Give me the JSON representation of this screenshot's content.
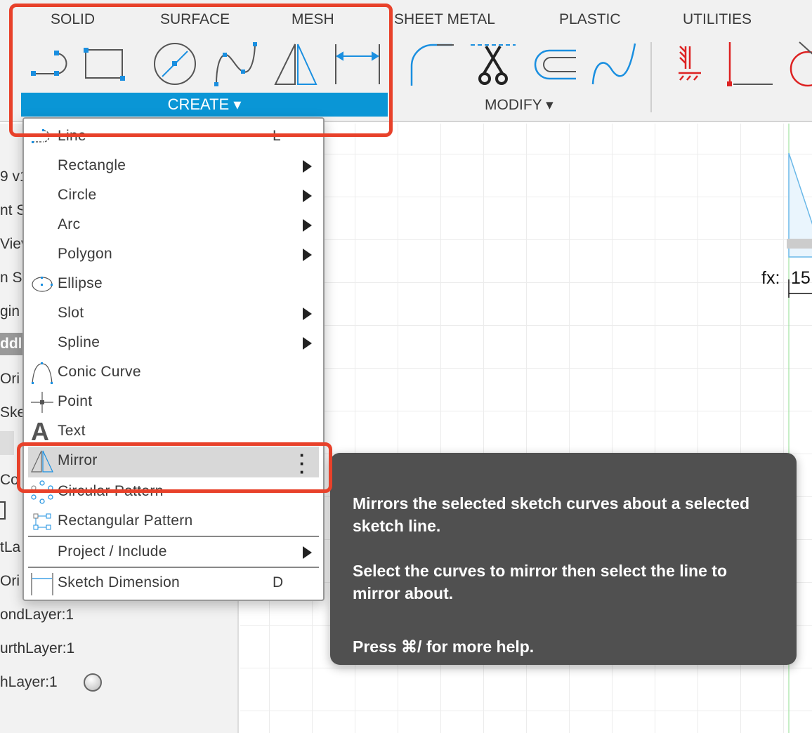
{
  "toolbar": {
    "tabs": [
      "SOLID",
      "SURFACE",
      "MESH",
      "SHEET METAL",
      "PLASTIC",
      "UTILITIES"
    ],
    "create_label": "CREATE",
    "modify_label": "MODIFY",
    "create_tools": [
      "line-icon",
      "rectangle-icon",
      "circle-icon",
      "spline-icon",
      "mirror-icon",
      "dimension-icon"
    ],
    "modify_tools": [
      "fillet-icon",
      "trim-icon",
      "offset-icon",
      "spline-icon"
    ],
    "constraint_tools": [
      "fix-constraint-icon",
      "coincident-icon",
      "tangent-icon"
    ],
    "accent": "#0a96d6"
  },
  "browser": {
    "partial_items": [
      "9 v1",
      "nt S",
      "Viev",
      "n Sc",
      "gin",
      "ddl",
      "Ori",
      "Ske",
      "Co",
      "tLa",
      "Ori",
      "ondLayer:1",
      "urthLayer:1",
      "hLayer:1"
    ]
  },
  "menu": {
    "items": [
      {
        "label": "Line",
        "shortcut": "L"
      },
      {
        "label": "Rectangle",
        "submenu": true
      },
      {
        "label": "Circle",
        "submenu": true
      },
      {
        "label": "Arc",
        "submenu": true
      },
      {
        "label": "Polygon",
        "submenu": true
      },
      {
        "label": "Ellipse"
      },
      {
        "label": "Slot",
        "submenu": true
      },
      {
        "label": "Spline",
        "submenu": true
      },
      {
        "label": "Conic Curve"
      },
      {
        "label": "Point"
      },
      {
        "label": "Text"
      },
      {
        "label": "Mirror",
        "highlighted": true
      },
      {
        "label": "Circular Pattern"
      },
      {
        "label": "Rectangular Pattern"
      },
      {
        "label": "Project / Include",
        "submenu": true
      },
      {
        "label": "Sketch Dimension",
        "shortcut": "D"
      }
    ]
  },
  "tooltip": {
    "line1": "Mirrors the selected sketch curves about a selected sketch line.",
    "line2": "Select the curves to mirror then select the line to mirror about.",
    "line3": "Press ⌘/ for more help."
  },
  "canvas": {
    "dimension_label": "fx:",
    "dimension_value": "15"
  },
  "highlight_color": "#e8412a"
}
